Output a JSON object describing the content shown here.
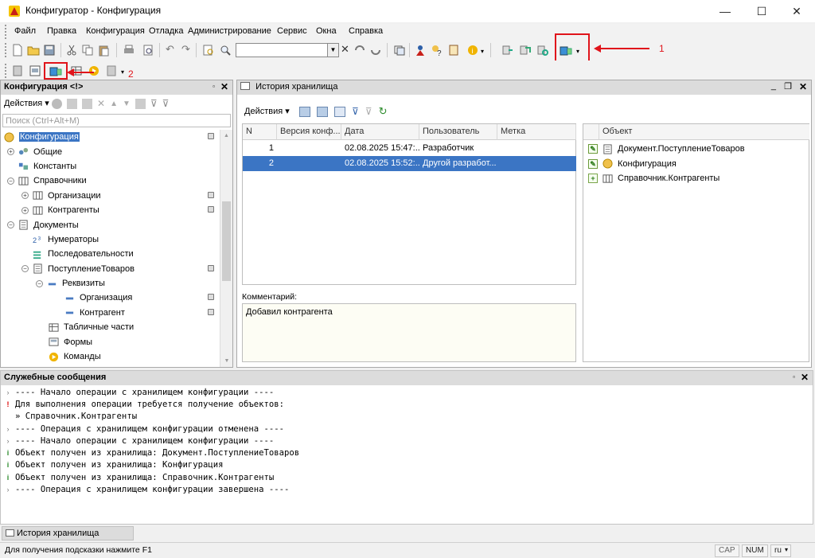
{
  "window": {
    "title": "Конфигуратор - Конфигурация",
    "minimize": "—",
    "maximize": "☐",
    "close": "✕"
  },
  "menu": [
    "Файл",
    "Правка",
    "Конфигурация",
    "Отладка",
    "Администрирование",
    "Сервис",
    "Окна",
    "Справка"
  ],
  "annotations": {
    "label1": "1",
    "label2": "2",
    "arrow_color": "#e0141b"
  },
  "config_panel": {
    "title": "Конфигурация <!>",
    "actions_label": "Действия",
    "search_placeholder": "Поиск (Ctrl+Alt+M)"
  },
  "tree": [
    {
      "label": "Конфигурация",
      "icon": "config-icon"
    },
    {
      "label": "Общие",
      "icon": "common-icon"
    },
    {
      "label": "Константы",
      "icon": "constants-icon"
    },
    {
      "label": "Справочники",
      "icon": "catalog-icon"
    },
    {
      "label": "Организации",
      "icon": "catalog-icon"
    },
    {
      "label": "Контрагенты",
      "icon": "catalog-icon"
    },
    {
      "label": "Документы",
      "icon": "document-icon"
    },
    {
      "label": "Нумераторы",
      "icon": "numerator-icon"
    },
    {
      "label": "Последовательности",
      "icon": "sequence-icon"
    },
    {
      "label": "ПоступлениеТоваров",
      "icon": "document-icon"
    },
    {
      "label": "Реквизиты",
      "icon": "attribute-icon"
    },
    {
      "label": "Организация",
      "icon": "attribute-icon"
    },
    {
      "label": "Контрагент",
      "icon": "attribute-icon"
    },
    {
      "label": "Табличные части",
      "icon": "tabular-icon"
    },
    {
      "label": "Формы",
      "icon": "form-icon"
    },
    {
      "label": "Команды",
      "icon": "command-icon"
    }
  ],
  "history": {
    "title": "История хранилища",
    "actions_label": "Действия",
    "columns": [
      "N",
      "Версия конф...",
      "Дата",
      "Пользователь",
      "Метка"
    ],
    "rows": [
      {
        "n": "1",
        "version": "",
        "date": "02.08.2025 15:47:...",
        "user": "Разработчик",
        "mark": ""
      },
      {
        "n": "2",
        "version": "",
        "date": "02.08.2025 15:52:...",
        "user": "Другой разработ...",
        "mark": ""
      }
    ],
    "objects_header": "Объект",
    "objects": [
      {
        "label": "Документ.ПоступлениеТоваров",
        "change": "edit"
      },
      {
        "label": "Конфигурация",
        "change": "edit"
      },
      {
        "label": "Справочник.Контрагенты",
        "change": "add"
      }
    ],
    "comment_label": "Комментарий:",
    "comment_text": "Добавил контрагента"
  },
  "messages": {
    "title": "Служебные сообщения",
    "lines": [
      {
        "icon": "›",
        "text": "---- Начало операции с хранилищем конфигурации ----"
      },
      {
        "icon": "!",
        "text": "Для выполнения операции требуется получение объектов:"
      },
      {
        "icon": "",
        "text": "»   Справочник.Контрагенты"
      },
      {
        "icon": "›",
        "text": "---- Операция с хранилищем конфигурации отменена ----"
      },
      {
        "icon": "›",
        "text": "---- Начало операции с хранилищем конфигурации ----"
      },
      {
        "icon": "i",
        "text": "Объект получен из хранилища: Документ.ПоступлениеТоваров"
      },
      {
        "icon": "i",
        "text": "Объект получен из хранилища: Конфигурация"
      },
      {
        "icon": "i",
        "text": "Объект получен из хранилища: Справочник.Контрагенты"
      },
      {
        "icon": "›",
        "text": "---- Операция с хранилищем конфигурации завершена ----"
      }
    ]
  },
  "taskbar": {
    "tab": "История хранилища"
  },
  "status": {
    "hint": "Для получения подсказки нажмите F1",
    "cap": "CAP",
    "num": "NUM",
    "lang": "ru"
  }
}
